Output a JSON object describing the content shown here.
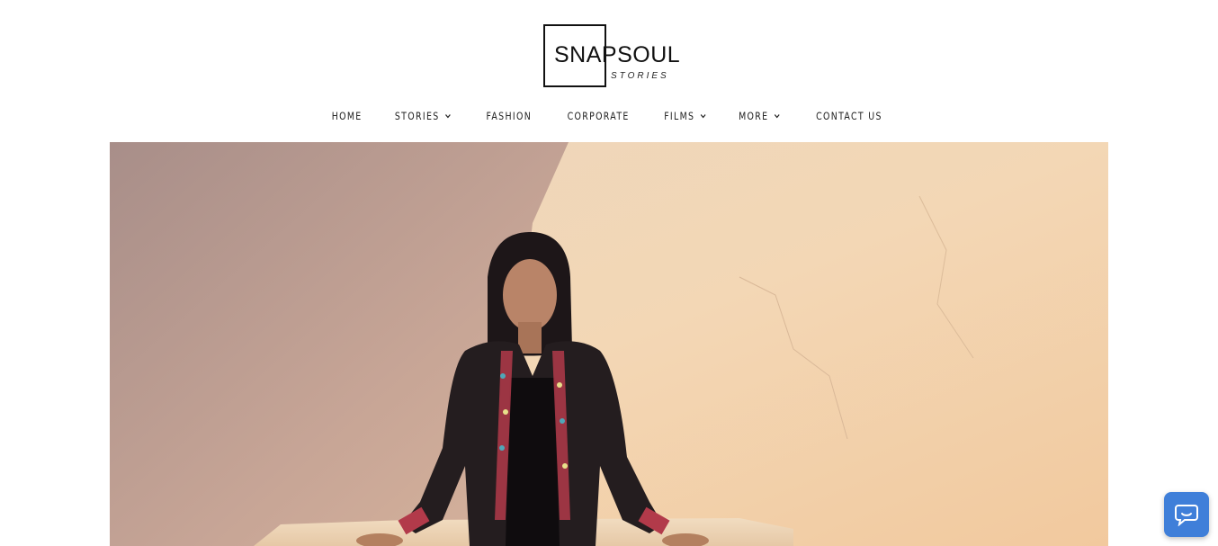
{
  "logo": {
    "brand": "SNAPSOUL",
    "sub": "STORIES"
  },
  "nav": {
    "items": [
      {
        "label": "HOME",
        "has_dropdown": false
      },
      {
        "label": "STORIES",
        "has_dropdown": true
      },
      {
        "label": "FASHION",
        "has_dropdown": false
      },
      {
        "label": "CORPORATE",
        "has_dropdown": false
      },
      {
        "label": "FILMS",
        "has_dropdown": true
      },
      {
        "label": "MORE",
        "has_dropdown": true
      },
      {
        "label": "CONTACT US",
        "has_dropdown": false
      }
    ]
  },
  "hero": {
    "icon": "fashion-photo"
  },
  "chat": {
    "icon": "chat-bubble-icon",
    "color": "#3f7fd9"
  }
}
